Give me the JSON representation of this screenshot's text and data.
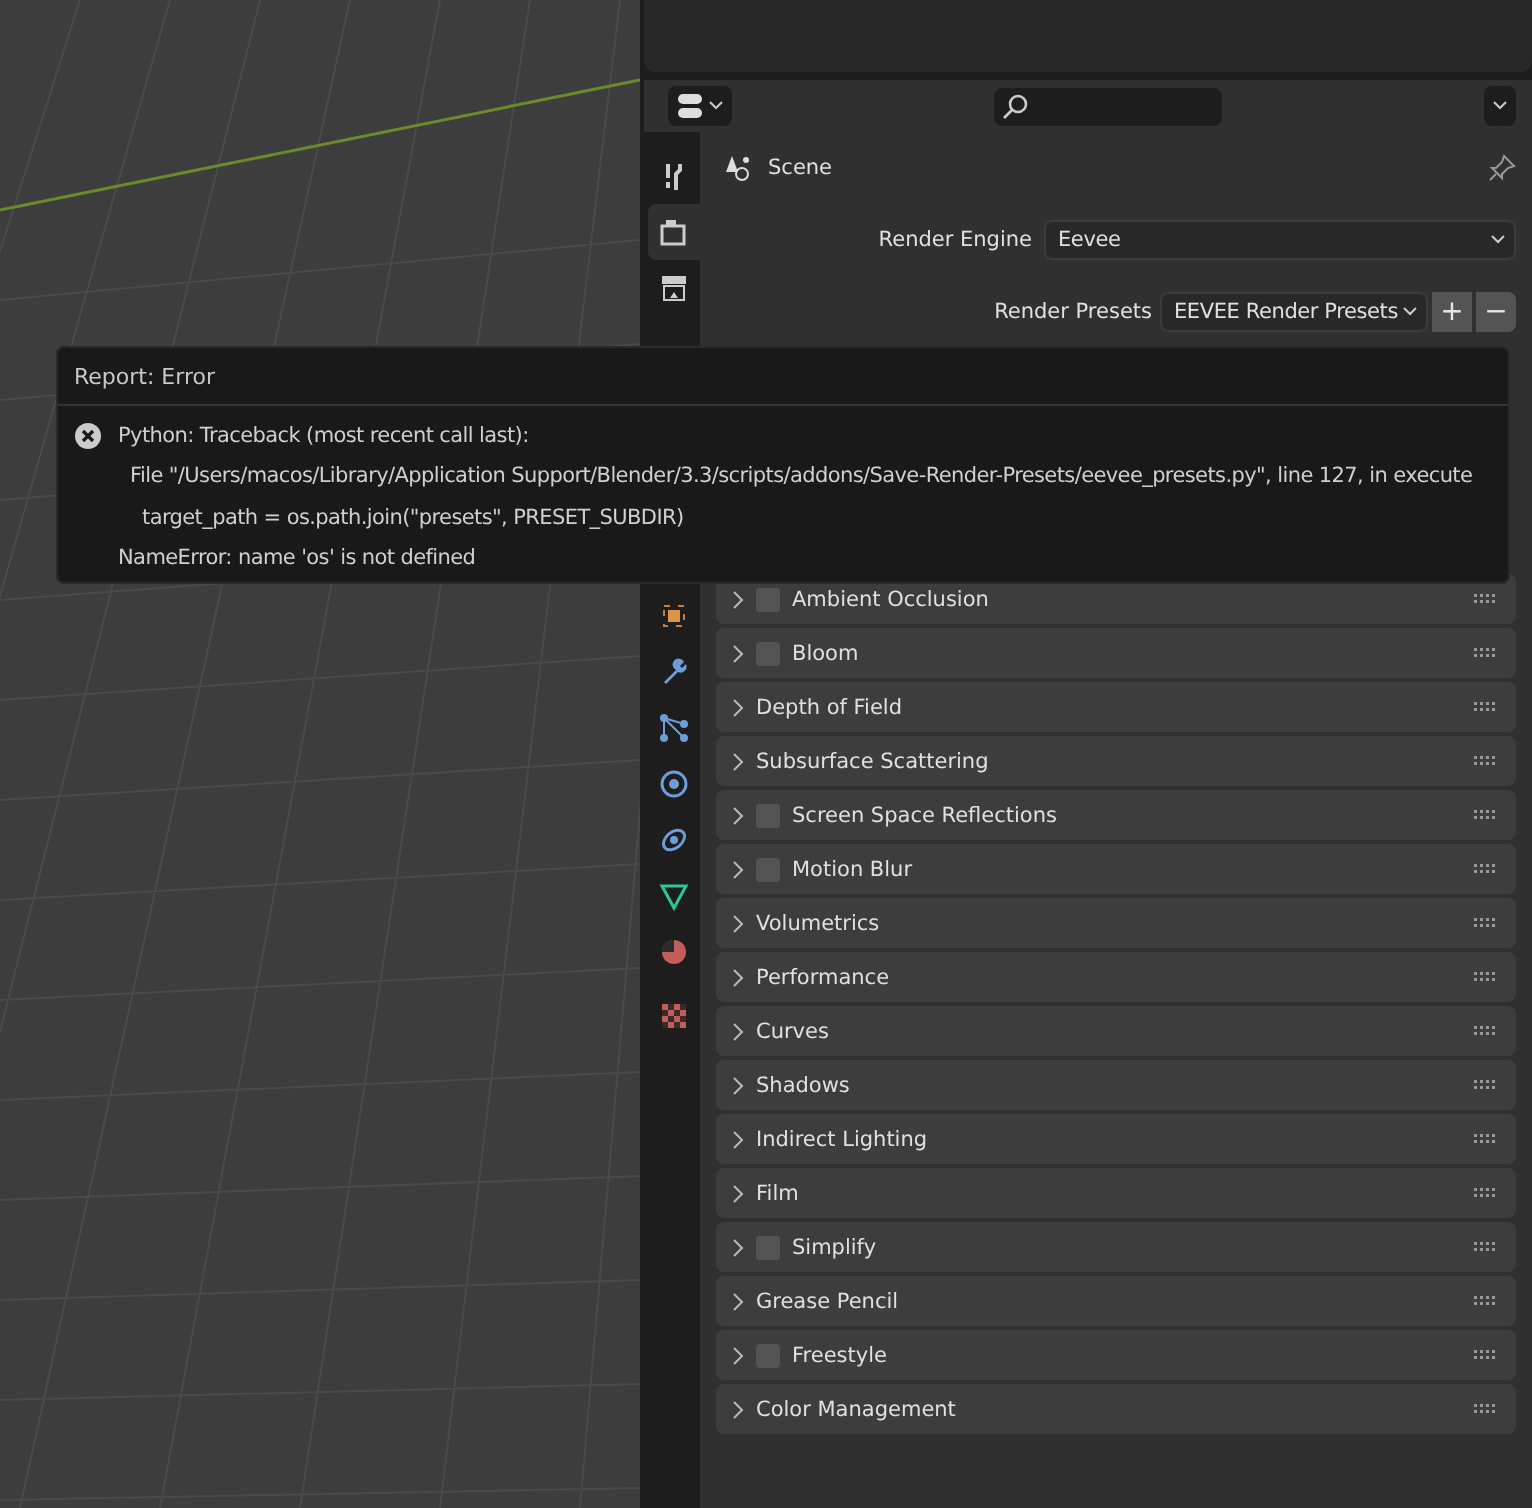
{
  "properties": {
    "context": "Scene",
    "tabs": [
      {
        "kind": "tool",
        "selected": false
      },
      {
        "kind": "render",
        "selected": true
      },
      {
        "kind": "output",
        "selected": false
      },
      {
        "kind": "object",
        "selected": false
      },
      {
        "kind": "modifier",
        "selected": false
      },
      {
        "kind": "particles",
        "selected": false
      },
      {
        "kind": "physics",
        "selected": false
      },
      {
        "kind": "constraints",
        "selected": false
      },
      {
        "kind": "data",
        "selected": false
      },
      {
        "kind": "material",
        "selected": false
      },
      {
        "kind": "texture",
        "selected": false
      }
    ],
    "render_engine": {
      "label": "Render Engine",
      "value": "Eevee"
    },
    "render_presets": {
      "label": "Render Presets",
      "value": "EEVEE Render Presets",
      "add": "+",
      "remove": "−"
    },
    "panels": [
      {
        "title": "Ambient Occlusion",
        "kind": "toggle",
        "checked": false
      },
      {
        "title": "Bloom",
        "kind": "toggle",
        "checked": false
      },
      {
        "title": "Depth of Field",
        "kind": "plain"
      },
      {
        "title": "Subsurface Scattering",
        "kind": "plain"
      },
      {
        "title": "Screen Space Reflections",
        "kind": "toggle",
        "checked": false
      },
      {
        "title": "Motion Blur",
        "kind": "toggle",
        "checked": false
      },
      {
        "title": "Volumetrics",
        "kind": "plain"
      },
      {
        "title": "Performance",
        "kind": "plain"
      },
      {
        "title": "Curves",
        "kind": "plain"
      },
      {
        "title": "Shadows",
        "kind": "plain"
      },
      {
        "title": "Indirect Lighting",
        "kind": "plain"
      },
      {
        "title": "Film",
        "kind": "plain"
      },
      {
        "title": "Simplify",
        "kind": "toggle",
        "checked": false
      },
      {
        "title": "Grease Pencil",
        "kind": "plain"
      },
      {
        "title": "Freestyle",
        "kind": "toggle",
        "checked": false
      },
      {
        "title": "Color Management",
        "kind": "plain"
      }
    ]
  },
  "report": {
    "title": "Report: Error",
    "lines": [
      {
        "text": "Python: Traceback (most recent call last):",
        "indent": false
      },
      {
        "text": "File \"/Users/macos/Library/Application Support/Blender/3.3/scripts/addons/Save-Render-Presets/eevee_presets.py\", line 127, in execute",
        "indent": true
      },
      {
        "text": "target_path = os.path.join(\"presets\", PRESET_SUBDIR)",
        "indent": true
      },
      {
        "text": "NameError: name 'os' is not defined",
        "indent": false
      }
    ]
  }
}
